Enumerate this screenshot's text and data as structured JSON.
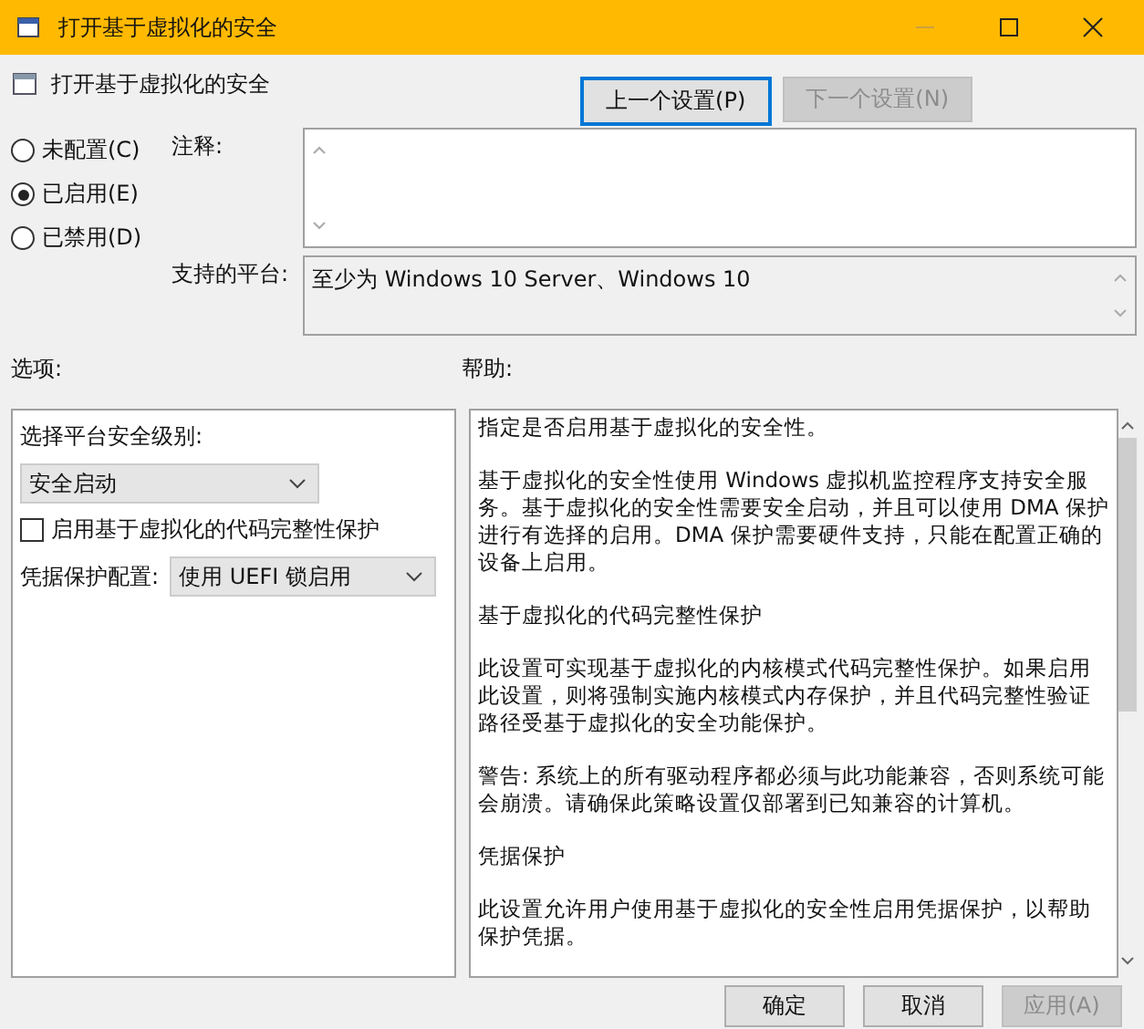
{
  "window": {
    "title": "打开基于虚拟化的安全"
  },
  "header": {
    "title": "打开基于虚拟化的安全"
  },
  "nav_buttons": [
    {
      "label": "上一个设置(P)",
      "disabled": false
    },
    {
      "label": "下一个设置(N)",
      "disabled": true
    }
  ],
  "state_options": [
    {
      "label": "未配置(C)",
      "selected": false
    },
    {
      "label": "已启用(E)",
      "selected": true
    },
    {
      "label": "已禁用(D)",
      "selected": false
    }
  ],
  "comment": {
    "label": "注释:"
  },
  "platform": {
    "label": "支持的平台:",
    "value": "至少为 Windows 10 Server、Windows 10"
  },
  "options": {
    "label": "选项:",
    "items": [
      {
        "kind": "label",
        "text": "选择平台安全级别:"
      },
      {
        "kind": "dropdown",
        "value": "安全启动"
      },
      {
        "kind": "checkbox",
        "label": "启用基于虚拟化的代码完整性保护",
        "checked": false
      },
      {
        "kind": "labeled_dropdown",
        "label": "凭据保护配置:",
        "value": "使用 UEFI 锁启用"
      }
    ]
  },
  "help": {
    "label": "帮助:",
    "paragraphs": [
      "指定是否启用基于虚拟化的安全性。",
      "基于虚拟化的安全性使用 Windows 虚拟机监控程序支持安全服务。基于虚拟化的安全性需要安全启动，并且可以使用 DMA 保护进行有选择的启用。DMA 保护需要硬件支持，只能在配置正确的设备上启用。",
      "基于虚拟化的代码完整性保护",
      "此设置可实现基于虚拟化的内核模式代码完整性保护。如果启用此设置，则将强制实施内核模式内存保护，并且代码完整性验证路径受基于虚拟化的安全功能保护。",
      "警告: 系统上的所有驱动程序都必须与此功能兼容，否则系统可能会崩溃。请确保此策略设置仅部署到已知兼容的计算机。",
      "凭据保护",
      "此设置允许用户使用基于虚拟化的安全性启用凭据保护，以帮助保护凭据。"
    ]
  },
  "footer_buttons": [
    {
      "label": "确定",
      "disabled": false
    },
    {
      "label": "取消",
      "disabled": false
    },
    {
      "label": "应用(A)",
      "disabled": true
    }
  ]
}
